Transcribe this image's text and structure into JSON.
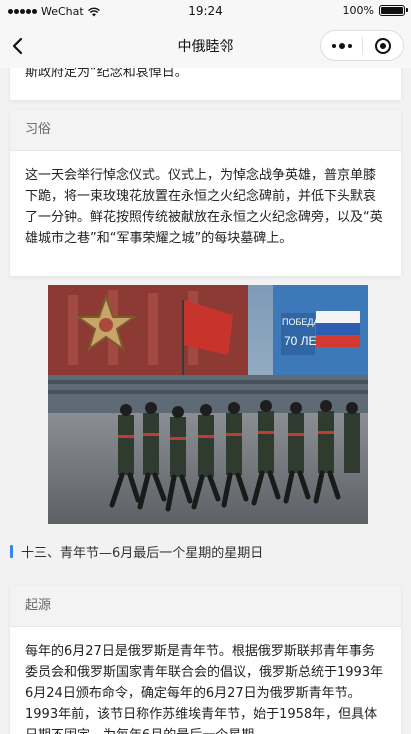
{
  "status_bar": {
    "carrier": "WeChat",
    "time": "19:24",
    "battery": "100%",
    "battery_level": 1.0
  },
  "nav": {
    "title": "中俄睦邻"
  },
  "card1": {
    "text": "斯政府定为“纪念和哀悼日。"
  },
  "card2": {
    "header": "习俗",
    "text": "这一天会举行悼念仪式。仪式上，为悼念战争英雄，普京单膝下跪，将一束玫瑰花放置在永恒之火纪念碑前，并低下头默哀了一分钟。鲜花按照传统被献放在永恒之火纪念碑旁，以及“英雄城市之巷”和“军事荣耀之城”的每块墓碑上。"
  },
  "photo": {
    "banner_text_1": "ПОБЕДА",
    "banner_text_2": "70 ЛЕТ"
  },
  "section13": {
    "title": "十三、青年节—6月最后一个星期的星期日"
  },
  "card3": {
    "header": "起源",
    "text": "每年的6月27日是俄罗斯是青年节。根据俄罗斯联邦青年事务委员会和俄罗斯国家青年联合会的倡议，俄罗斯总统于1993年6月24日颁布命令，确定每年的6月27日为俄罗斯青年节。　　1993年前，该节日称作苏维埃青年节，始于1958年，但具体日期不固定，为每年6月的最后一个星期"
  },
  "colors": {
    "accent": "#3b82f6",
    "nav_bg": "#f7f7f7",
    "page_bg": "#f2f2f2",
    "card_header_bg": "#f3f3f3"
  }
}
